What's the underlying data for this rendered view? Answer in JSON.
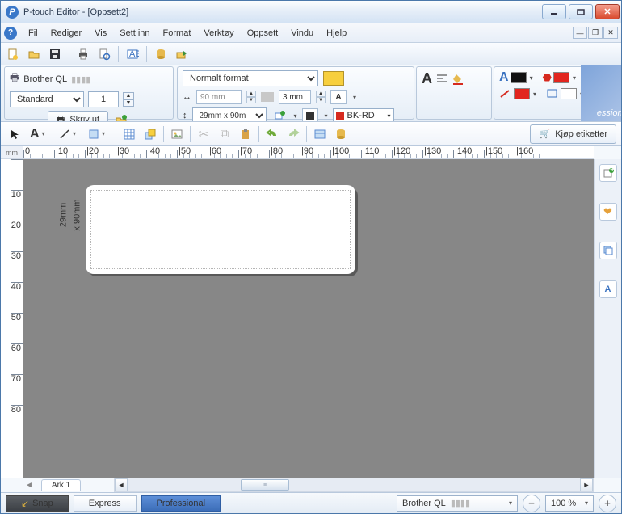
{
  "window": {
    "title": "P-touch Editor - [Oppsett2]"
  },
  "menu": {
    "items": [
      "Fil",
      "Rediger",
      "Vis",
      "Sett inn",
      "Format",
      "Verktøy",
      "Oppsett",
      "Vindu",
      "Hjelp"
    ]
  },
  "printer_panel": {
    "device": "Brother QL",
    "mode": "Standard",
    "copies": "1",
    "print_label": "Skriv ut"
  },
  "layout_panel": {
    "format_sel": "Normalt format",
    "width": "90 mm",
    "margin": "3 mm",
    "size_sel": "29mm x 90m",
    "tape_sel": "BK-RD"
  },
  "brand": "essional",
  "tools2": {
    "buy_label": "Kjøp etiketter"
  },
  "ruler_unit": "mm",
  "label_size": {
    "line1": "29mm",
    "line2": "x 90mm"
  },
  "sheet": "Ark 1",
  "status": {
    "snap": "Snap",
    "express": "Express",
    "professional": "Professional",
    "printer": "Brother QL",
    "zoom": "100 %"
  },
  "hruler_vals": [
    "0",
    "10",
    "20",
    "30",
    "40",
    "50",
    "60",
    "70",
    "80",
    "90",
    "100",
    "110",
    "120",
    "130",
    "140",
    "150",
    "160"
  ],
  "vruler_vals": [
    "",
    "10",
    "20",
    "30",
    "40",
    "50",
    "60",
    "70",
    "80"
  ]
}
